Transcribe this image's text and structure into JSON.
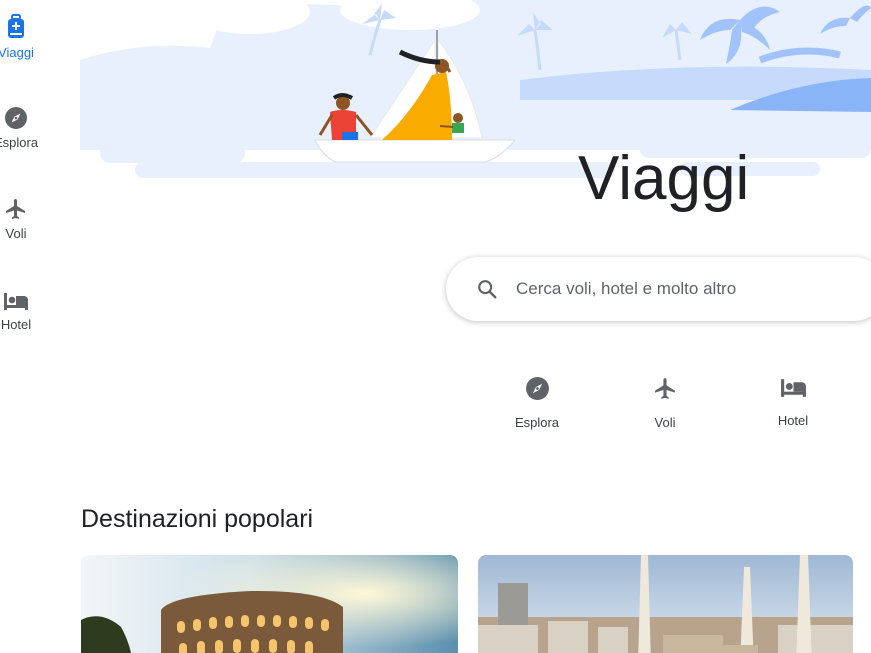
{
  "sidebar": {
    "items": [
      {
        "label": "Viaggi",
        "icon": "travel-bag-icon",
        "active": true
      },
      {
        "label": "Esplora",
        "icon": "compass-icon",
        "active": false
      },
      {
        "label": "Voli",
        "icon": "airplane-icon",
        "active": false
      },
      {
        "label": "Hotel",
        "icon": "bed-icon",
        "active": false
      }
    ]
  },
  "hero": {
    "title": "Viaggi"
  },
  "search": {
    "placeholder": "Cerca voli, hotel e molto altro"
  },
  "quick_links": [
    {
      "label": "Esplora",
      "icon": "compass-icon"
    },
    {
      "label": "Voli",
      "icon": "airplane-icon"
    },
    {
      "label": "Hotel",
      "icon": "bed-icon"
    }
  ],
  "destinations": {
    "title": "Destinazioni popolari",
    "cards": [
      {
        "image": "colosseum-photo"
      },
      {
        "image": "milan-cathedral-photo"
      }
    ]
  },
  "colors": {
    "accent": "#1a73e8",
    "icon_gray": "#5f6368",
    "hero_sky": "#e8f0fe"
  }
}
